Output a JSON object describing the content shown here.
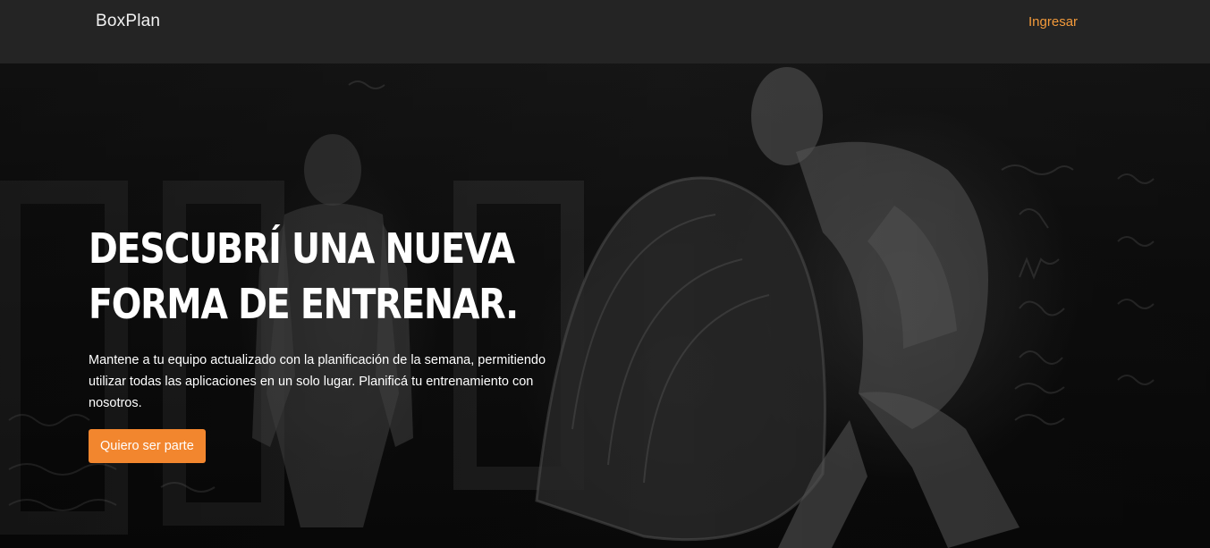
{
  "navbar": {
    "brand": "BoxPlan",
    "login_label": "Ingresar"
  },
  "hero": {
    "title_line1": "DESCUBRÍ UNA NUEVA",
    "title_line2": "FORMA DE ENTRENAR.",
    "description": "Mantene a tu equipo actualizado con la planificación de la semana, permitiendo utilizar todas las aplicaciones en un solo lugar. Planificá tu entrenamiento con nosotros.",
    "cta_label": "Quiero ser parte",
    "background": "black-and-white photo of two athletes flipping a tire in front of a chalkboard wall"
  },
  "colors": {
    "accent": "#f2862e",
    "link": "#f39a3b",
    "navbar": "#262626",
    "text": "#ffffff"
  }
}
